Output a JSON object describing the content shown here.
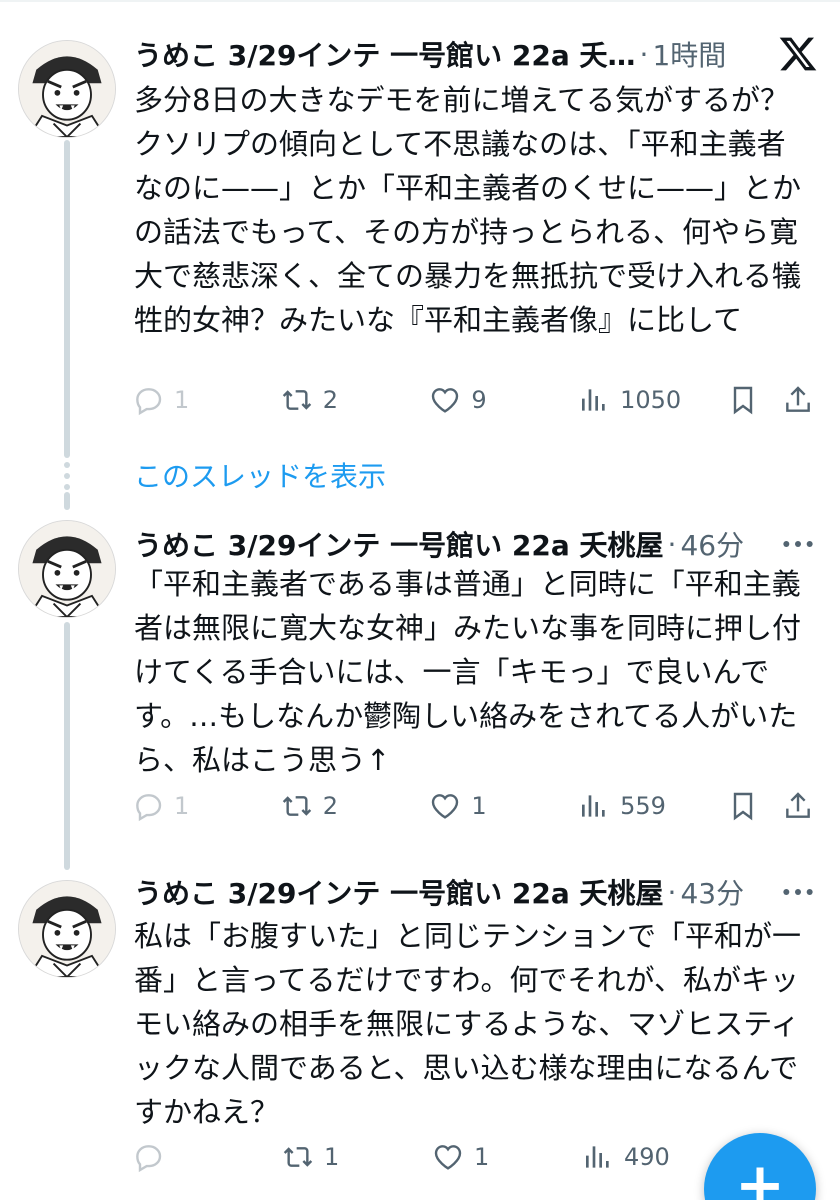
{
  "tweets": [
    {
      "author": "うめこ 3/29インテ 一号館い 22a 夭…",
      "separator": "·",
      "time": "1時間",
      "text": "多分8日の大きなデモを前に増えてる気がするが？クソリプの傾向として不思議なのは、「平和主義者なのに——」とか「平和主義者のくせに——」とかの話法でもって、その方が持っとられる、何やら寛大で慈悲深く、全ての暴力を無抵抗で受け入れる犠牲的女神？みたいな『平和主義者像』に比して",
      "replies": "1",
      "retweets": "2",
      "likes": "9",
      "views": "1050"
    },
    {
      "author": "うめこ 3/29インテ 一号館い 22a 夭桃屋",
      "separator": "·",
      "time": "46分",
      "text": "「平和主義者である事は普通」と同時に「平和主義者は無限に寛大な女神」みたいな事を同時に押し付けてくる手合いには、一言「キモっ」で良いんです。…もしなんか鬱陶しい絡みをされてる人がいたら、私はこう思う↑",
      "replies": "1",
      "retweets": "2",
      "likes": "1",
      "views": "559"
    },
    {
      "author": "うめこ 3/29インテ 一号館い 22a 夭桃屋",
      "separator": "·",
      "time": "43分",
      "text": "私は「お腹すいた」と同じテンションで「平和が一番」と言ってるだけですわ。何でそれが、私がキッモい絡みの相手を無限にするような、マゾヒスティックな人間であると、思い込む様な理由になるんですかねえ？",
      "replies": "",
      "retweets": "1",
      "likes": "1",
      "views": "490"
    }
  ],
  "show_thread_label": "このスレッドを表示",
  "fab_label": "+",
  "colors": {
    "accent": "#1d9bf0",
    "secondary_text": "#536471",
    "thread_line": "#cfd9de"
  },
  "icons": [
    "x-logo-icon",
    "more-icon",
    "reply-icon",
    "retweet-icon",
    "like-icon",
    "views-icon",
    "bookmark-icon",
    "share-icon"
  ]
}
